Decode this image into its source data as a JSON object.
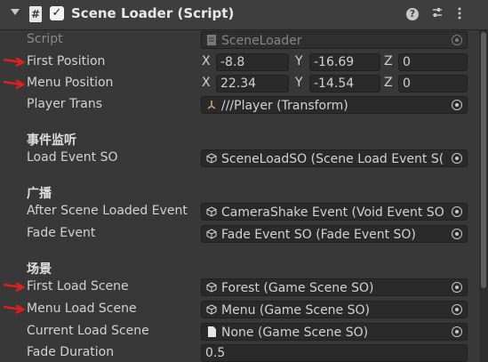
{
  "header": {
    "title": "Scene Loader (Script)",
    "hash_symbol": "#",
    "check_symbol": "✓"
  },
  "rows": {
    "script": {
      "label": "Script",
      "value": "SceneLoader"
    },
    "first_position": {
      "label": "First Position",
      "x": "-8.8",
      "y": "-16.69",
      "z": "0"
    },
    "menu_position": {
      "label": "Menu Position",
      "x": "22.34",
      "y": "-14.54",
      "z": "0"
    },
    "player_trans": {
      "label": "Player Trans",
      "value": "///Player (Transform)"
    },
    "section_events": "事件监听",
    "load_event_so": {
      "label": "Load Event SO",
      "value": "SceneLoadSO (Scene Load Event S("
    },
    "section_broadcast": "广播",
    "after_scene_loaded_event": {
      "label": "After Scene Loaded Event",
      "value": "CameraShake Event (Void Event SO"
    },
    "fade_event": {
      "label": "Fade Event",
      "value": "Fade Event SO (Fade Event SO)"
    },
    "section_scene": "场景",
    "first_load_scene": {
      "label": "First Load Scene",
      "value": "Forest (Game Scene SO)"
    },
    "menu_load_scene": {
      "label": "Menu Load Scene",
      "value": "Menu (Game Scene SO)"
    },
    "current_load_scene": {
      "label": "Current Load Scene",
      "value": "None (Game Scene SO)"
    },
    "fade_duration": {
      "label": "Fade Duration",
      "value": "0.5"
    }
  },
  "axis_labels": {
    "x": "X",
    "y": "Y",
    "z": "Z"
  },
  "colors": {
    "arrow": "#e0201c",
    "so_icon": "#d9d9d9",
    "transform_icon": "#e8a33d"
  }
}
